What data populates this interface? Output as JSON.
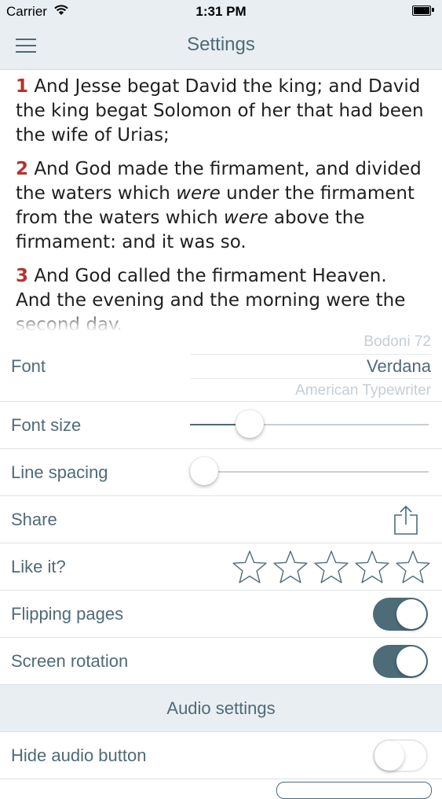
{
  "status_bar": {
    "carrier": "Carrier",
    "time": "1:31 PM"
  },
  "nav": {
    "title": "Settings"
  },
  "verses": [
    {
      "num": "1",
      "parts": [
        {
          "text": "And Jesse begat David the king; and David the king begat Solomon of her that had been the wife of Urias;",
          "italic": false
        }
      ]
    },
    {
      "num": "2",
      "parts": [
        {
          "text": "And God made the firmament, and divided the waters which ",
          "italic": false
        },
        {
          "text": "were",
          "italic": true
        },
        {
          "text": " under the firmament from the waters which ",
          "italic": false
        },
        {
          "text": "were",
          "italic": true
        },
        {
          "text": " above the firmament: and it was so.",
          "italic": false
        }
      ]
    },
    {
      "num": "3",
      "parts": [
        {
          "text": "And God called the firmament Heaven. And the evening and the morning were the second day.",
          "italic": false
        }
      ]
    }
  ],
  "settings": {
    "font": {
      "label": "Font",
      "options": [
        "Bodoni 72",
        "Verdana",
        "American Typewriter"
      ],
      "selected": "Verdana"
    },
    "font_size": {
      "label": "Font size",
      "value": 0.25
    },
    "line_spacing": {
      "label": "Line spacing",
      "value": 0.06
    },
    "share": {
      "label": "Share",
      "icon": "share-icon"
    },
    "like": {
      "label": "Like it?",
      "stars_total": 5,
      "stars_filled": 0,
      "icon": "star-outline-icon"
    },
    "flipping_pages": {
      "label": "Flipping pages",
      "on": true
    },
    "screen_rotation": {
      "label": "Screen rotation",
      "on": true
    },
    "audio_header": "Audio settings",
    "hide_audio": {
      "label": "Hide audio button",
      "on": false
    }
  },
  "colors": {
    "accent": "#4e6b78",
    "verse_number": "#b5322c",
    "bar_bg": "#e9eef2"
  }
}
